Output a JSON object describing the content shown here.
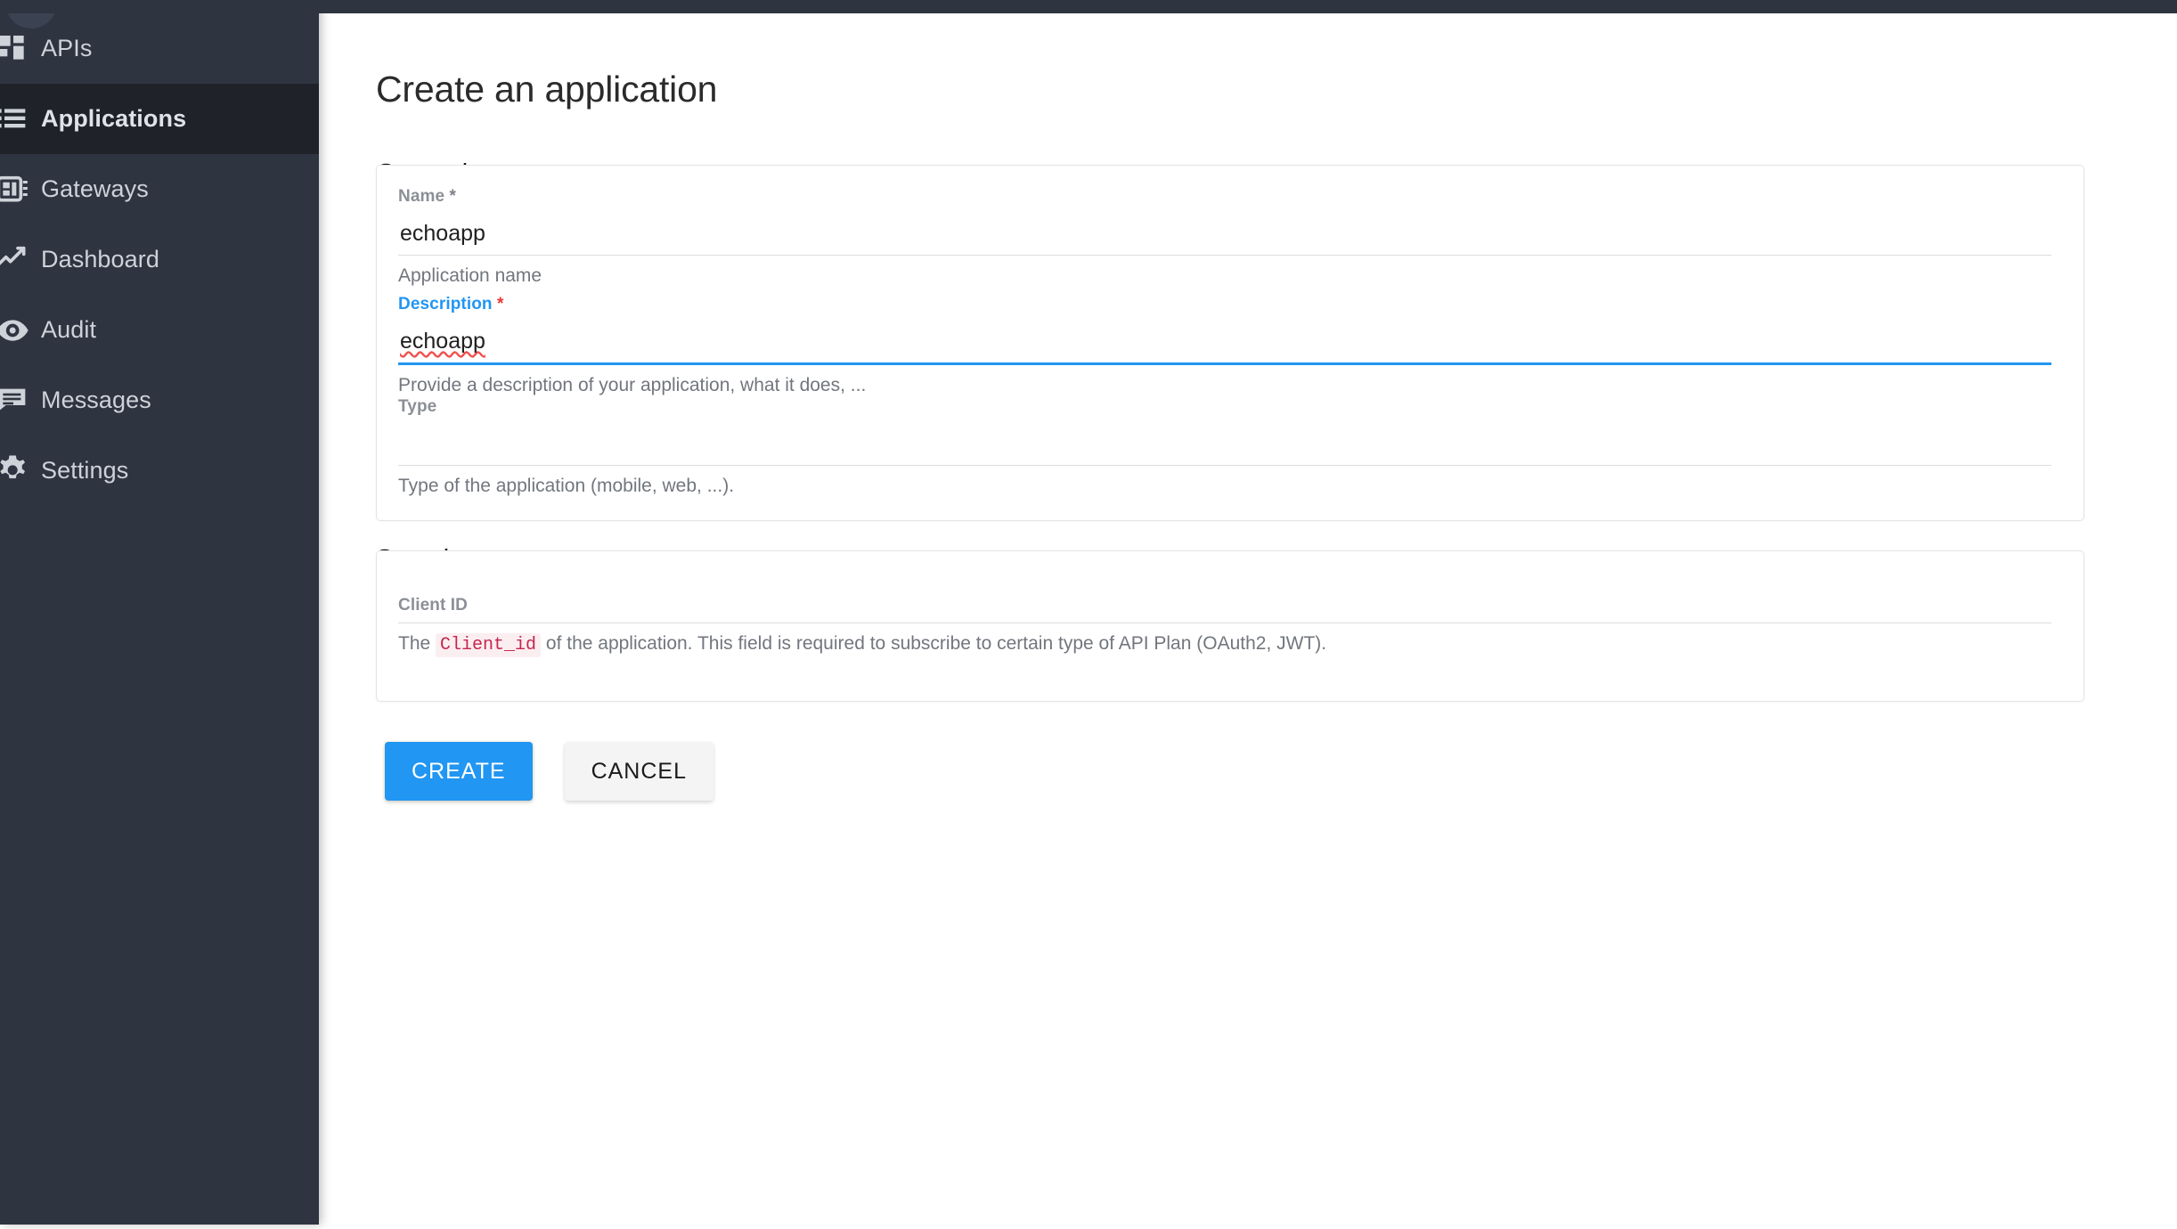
{
  "colors": {
    "sidebar_bg": "#2e3440",
    "sidebar_active_bg": "#1f2229",
    "accent": "#2196f3",
    "required_star": "#e53935",
    "code_text": "#c7254e",
    "code_bg": "#fbeef1"
  },
  "sidebar": {
    "items": [
      {
        "label": "APIs",
        "icon": "apis-grid-icon",
        "active": false
      },
      {
        "label": "Applications",
        "icon": "applications-list-icon",
        "active": true
      },
      {
        "label": "Gateways",
        "icon": "gateways-icon",
        "active": false
      },
      {
        "label": "Dashboard",
        "icon": "dashboard-chart-icon",
        "active": false
      },
      {
        "label": "Audit",
        "icon": "audit-eye-icon",
        "active": false
      },
      {
        "label": "Messages",
        "icon": "messages-icon",
        "active": false
      },
      {
        "label": "Settings",
        "icon": "settings-gear-icon",
        "active": false
      }
    ]
  },
  "page": {
    "title": "Create an application"
  },
  "sections": {
    "general": {
      "title": "General",
      "fields": {
        "name": {
          "label": "Name",
          "required_marker": "*",
          "value": "echoapp",
          "hint": "Application name",
          "focused": false,
          "spellcheck_error": false
        },
        "description": {
          "label": "Description",
          "required_marker": "*",
          "value": "echoapp",
          "hint": "Provide a description of your application, what it does, ...",
          "focused": true,
          "spellcheck_error": true
        },
        "type": {
          "label": "Type",
          "required_marker": "",
          "value": "",
          "hint": "Type of the application (mobile, web, ...).",
          "focused": false,
          "spellcheck_error": false
        }
      }
    },
    "security": {
      "title": "Security",
      "fields": {
        "client_id": {
          "label": "Client ID",
          "required_marker": "",
          "value": "",
          "hint_before": "The ",
          "hint_code": "Client_id",
          "hint_after": " of the application. This field is required to subscribe to certain type of API Plan (OAuth2, JWT).",
          "focused": false
        }
      }
    }
  },
  "actions": {
    "create_label": "CREATE",
    "cancel_label": "CANCEL"
  }
}
